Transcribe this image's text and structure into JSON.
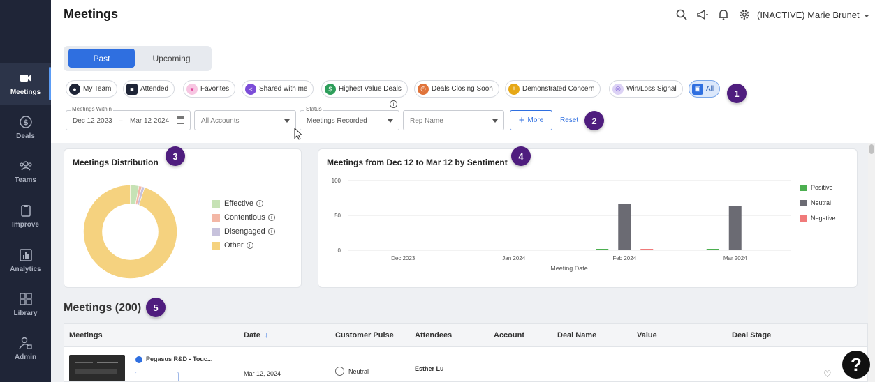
{
  "nav": {
    "items": [
      {
        "label": "Meetings",
        "icon": "video-icon"
      },
      {
        "label": "Deals",
        "icon": "dollar-icon"
      },
      {
        "label": "Teams",
        "icon": "people-icon"
      },
      {
        "label": "Improve",
        "icon": "clipboard-icon"
      },
      {
        "label": "Analytics",
        "icon": "bar-chart-icon"
      },
      {
        "label": "Library",
        "icon": "grid-icon"
      },
      {
        "label": "Admin",
        "icon": "admin-icon"
      }
    ]
  },
  "header": {
    "title": "Meetings",
    "user": "(INACTIVE) Marie Brunet"
  },
  "tabs": {
    "past": "Past",
    "upcoming": "Upcoming"
  },
  "chips": [
    {
      "label": "My Team",
      "color": "#1f2537"
    },
    {
      "label": "Attended",
      "color": "#1f2537"
    },
    {
      "label": "Favorites",
      "color": "#e879b9"
    },
    {
      "label": "Shared with me",
      "color": "#7c4dd8"
    },
    {
      "label": "Highest Value Deals",
      "color": "#2e9e5b"
    },
    {
      "label": "Deals Closing Soon",
      "color": "#e0733a"
    },
    {
      "label": "Demonstrated Concern",
      "color": "#e6a817"
    },
    {
      "label": "Win/Loss Signal",
      "color": "#a58be0"
    },
    {
      "label": "All",
      "color": "#2f6fe0"
    }
  ],
  "filters": {
    "meetings_within_label": "Meetings Within",
    "date_from": "Dec 12 2023",
    "date_sep": "–",
    "date_to": "Mar 12 2024",
    "accounts": "All Accounts",
    "status_label": "Status",
    "status": "Meetings Recorded",
    "rep": "Rep Name",
    "more": "More",
    "reset": "Reset"
  },
  "badges": [
    "1",
    "2",
    "3",
    "4",
    "5"
  ],
  "distribution": {
    "title": "Meetings Distribution",
    "legend": [
      {
        "label": "Effective",
        "color": "#c6e2b5"
      },
      {
        "label": "Contentious",
        "color": "#f3b7a6"
      },
      {
        "label": "Disengaged",
        "color": "#c7c2dc"
      },
      {
        "label": "Other",
        "color": "#f5d27f"
      }
    ]
  },
  "chart_data": [
    {
      "type": "pie",
      "title": "Meetings Distribution",
      "categories": [
        "Effective",
        "Contentious",
        "Disengaged",
        "Other"
      ],
      "values": [
        3,
        1,
        1,
        95
      ]
    },
    {
      "type": "bar",
      "title": "Meetings from Dec 12 to Mar 12 by Sentiment",
      "xlabel": "Meeting Date",
      "ylabel": "",
      "categories": [
        "Dec 2023",
        "Jan 2024",
        "Feb 2024",
        "Mar 2024"
      ],
      "yticks": [
        "0",
        "50",
        "100"
      ],
      "ylim": [
        0,
        100
      ],
      "series": [
        {
          "name": "Positive",
          "color": "#4caf50",
          "values": [
            0,
            0,
            2,
            2
          ]
        },
        {
          "name": "Neutral",
          "color": "#6b6b73",
          "values": [
            0,
            0,
            67,
            63
          ]
        },
        {
          "name": "Negative",
          "color": "#f07a7a",
          "values": [
            0,
            0,
            1,
            0
          ]
        }
      ],
      "legend_position": "right"
    }
  ],
  "meetings": {
    "title": "Meetings (200)",
    "columns": [
      "Meetings",
      "Date",
      "Customer Pulse",
      "Attendees",
      "Account",
      "Deal Name",
      "Value",
      "Deal Stage"
    ],
    "rows": [
      {
        "name": "Pegasus R&D - Touc...",
        "date": "Mar 12, 2024",
        "pulse": "Neutral",
        "attendee": "Esther Lu"
      }
    ]
  },
  "help": "?"
}
